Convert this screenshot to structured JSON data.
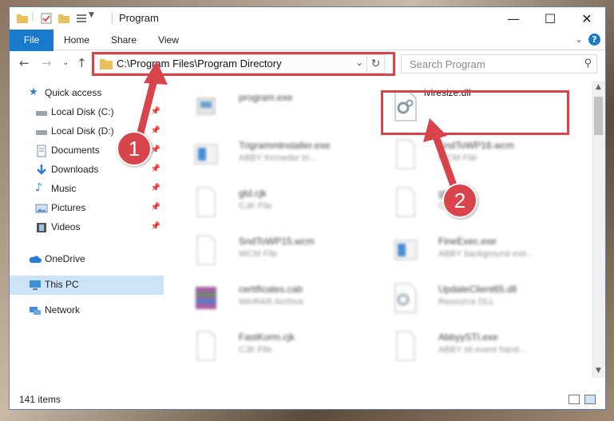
{
  "window": {
    "title": "Program",
    "minimize": "—",
    "maximize": "☐",
    "close": "✕"
  },
  "ribbon": {
    "tabs": [
      {
        "label": "File"
      },
      {
        "label": "Home"
      },
      {
        "label": "Share"
      },
      {
        "label": "View"
      }
    ],
    "expand": "⌄",
    "help": "?"
  },
  "address": {
    "path": "C:\\Program Files\\Program Directory",
    "search_placeholder": "Search Program"
  },
  "sidebar": {
    "items": [
      {
        "label": "Quick access",
        "icon": "star-icon"
      },
      {
        "label": "Local Disk (C:)",
        "icon": "drive-icon"
      },
      {
        "label": "Local Disk (D:)",
        "icon": "drive-icon"
      },
      {
        "label": "Documents",
        "icon": "documents-icon"
      },
      {
        "label": "Downloads",
        "icon": "downloads-icon"
      },
      {
        "label": "Music",
        "icon": "music-icon"
      },
      {
        "label": "Pictures",
        "icon": "pictures-icon"
      },
      {
        "label": "Videos",
        "icon": "videos-icon"
      },
      {
        "label": "OneDrive",
        "icon": "cloud-icon"
      },
      {
        "label": "This PC",
        "icon": "computer-icon"
      },
      {
        "label": "Network",
        "icon": "network-icon"
      }
    ]
  },
  "files": [
    {
      "name": "program.exe",
      "type": ""
    },
    {
      "name": "iviresize.dll",
      "type": ""
    },
    {
      "name": "Trigrammlnstaller.exe",
      "type": "ABBY fnrmeder tri..."
    },
    {
      "name": "SndToWP16.wcm",
      "type": "WCM File"
    },
    {
      "name": "gtd.cjk",
      "type": "CJK File"
    },
    {
      "name": "gtd.cjk",
      "type": "CJK File"
    },
    {
      "name": "SndToWP15.wcm",
      "type": "WCM File"
    },
    {
      "name": "FineExec.exe",
      "type": "ABBY background exe..."
    },
    {
      "name": "certificates.cab",
      "type": "WinRAR Archive"
    },
    {
      "name": "UpdateClient65.dll",
      "type": "Resource DLL"
    },
    {
      "name": "FastKorm.cjk",
      "type": "CJK File"
    },
    {
      "name": "AbbyySTI.exe",
      "type": "ABBY sti event hand..."
    }
  ],
  "status": {
    "count": "141 items"
  },
  "annotations": {
    "step1": "1",
    "step2": "2",
    "color": "#d9434c"
  }
}
